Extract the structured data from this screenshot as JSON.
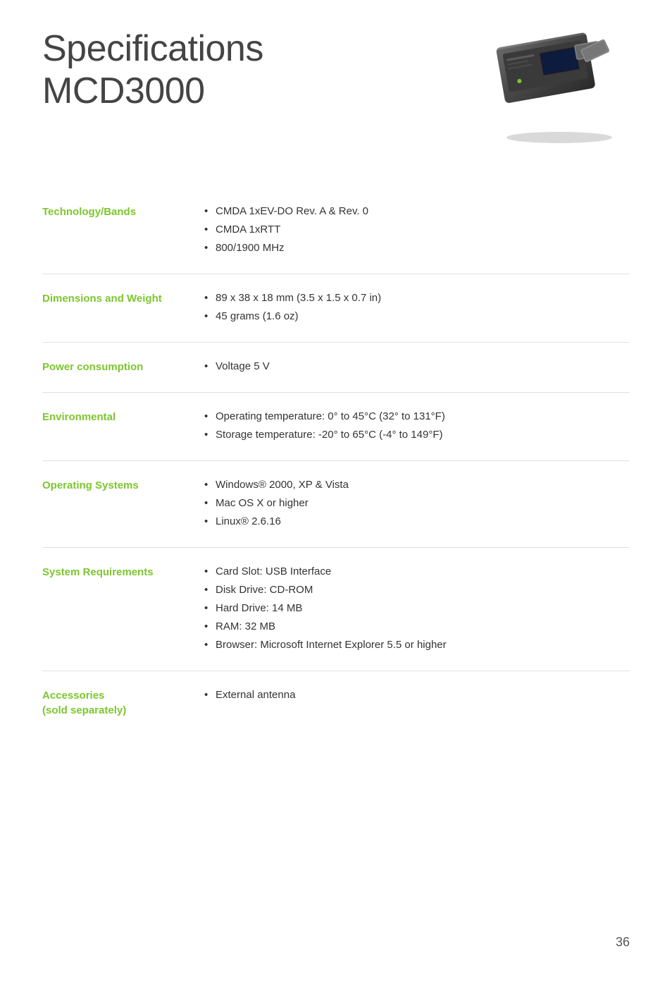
{
  "header": {
    "title": "Specifications",
    "model": "MCD3000"
  },
  "specs": [
    {
      "label": "Technology/Bands",
      "items": [
        "CMDA 1xEV-DO Rev. A & Rev. 0",
        "CMDA 1xRTT",
        "800/1900 MHz"
      ]
    },
    {
      "label": "Dimensions and Weight",
      "items": [
        "89 x 38 x 18 mm (3.5 x 1.5 x 0.7 in)",
        "45 grams (1.6 oz)"
      ]
    },
    {
      "label": "Power consumption",
      "items": [
        "Voltage 5 V"
      ]
    },
    {
      "label": "Environmental",
      "items": [
        "Operating temperature: 0° to 45°C (32° to 131°F)",
        "Storage temperature:  -20° to 65°C (-4° to 149°F)"
      ]
    },
    {
      "label": "Operating Systems",
      "items": [
        "Windows® 2000, XP & Vista",
        "Mac OS X or higher",
        "Linux® 2.6.16"
      ]
    },
    {
      "label": "System Requirements",
      "items": [
        "Card Slot: USB Interface",
        "Disk Drive: CD-ROM",
        "Hard Drive: 14 MB",
        "RAM: 32 MB",
        "Browser: Microsoft Internet Explorer 5.5 or higher"
      ]
    },
    {
      "label": "Accessories\n(sold separately)",
      "items": [
        "External antenna"
      ]
    }
  ],
  "page_number": "36"
}
